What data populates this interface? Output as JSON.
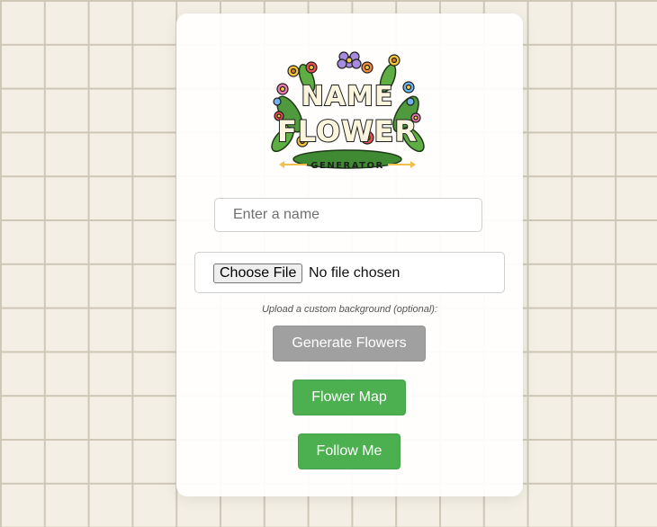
{
  "logo": {
    "line1": "NAME",
    "line2": "FLOWER",
    "subtitle": "GENERATOR"
  },
  "name_input": {
    "placeholder": "Enter a name",
    "value": ""
  },
  "file_input": {
    "button_label": "Choose File",
    "status": "No file chosen"
  },
  "upload_hint": "Upload a custom background (optional):",
  "buttons": {
    "generate": "Generate Flowers",
    "map": "Flower Map",
    "follow": "Follow Me"
  },
  "colors": {
    "background": "#f3efe4",
    "grid_line": "#cfc7b6",
    "card": "#ffffff",
    "generate_button": "#a0a0a0",
    "green_button": "#4caf50",
    "logo_accent": "#f0c04a"
  }
}
